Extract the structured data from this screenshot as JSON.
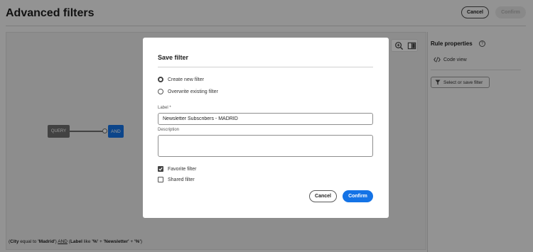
{
  "header": {
    "title": "Advanced filters",
    "cancel_label": "Cancel",
    "confirm_label": "Confirm"
  },
  "canvas": {
    "nodes": {
      "query": "QUERY",
      "and": "AND"
    },
    "expression": {
      "open": "(",
      "field1": "City",
      "op1": " equal to ",
      "val1": "'Madrid'",
      "close1": ") ",
      "conj": "AND",
      "open2": " (",
      "field2": "Label",
      "op2": " like ",
      "val2a": "'%'",
      "plus1": " + ",
      "val2b": "'Newsletter'",
      "plus2": " + ",
      "val2c": "'%'",
      "close2": ")"
    },
    "tools": [
      "zoom-in-icon",
      "columns-icon"
    ]
  },
  "panel": {
    "title": "Rule properties",
    "code_view_label": "Code view",
    "select_save_label": "Select or save filter"
  },
  "dialog": {
    "title": "Save filter",
    "radio_create": "Create new filter",
    "radio_overwrite": "Overwrite existing filter",
    "selected_option": "Create new filter",
    "label_field_label": "Label",
    "label_required_mark": "*",
    "label_value": "Newsletter Subscribers - MADRID",
    "description_label": "Description",
    "description_value": "",
    "favorite_label": "Favorite filter",
    "favorite_checked": true,
    "shared_label": "Shared filter",
    "shared_checked": false,
    "cancel_label": "Cancel",
    "confirm_label": "Confirm"
  },
  "colors": {
    "accent": "#1473e6",
    "overlay": "rgba(0,0,0,0.4)"
  }
}
